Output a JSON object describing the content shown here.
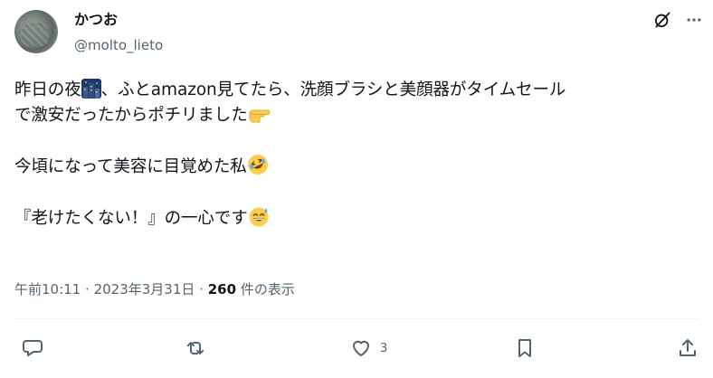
{
  "author": {
    "name": "かつお",
    "handle": "@molto_lieto"
  },
  "tweet": {
    "line1_a": "昨日の夜",
    "line1_b": "、ふとamazon見てたら、洗顔ブラシと美顔器がタイムセール",
    "line2": "で激安だったからポチリました",
    "line3": "今頃になって美容に目覚めた私",
    "line4": "『老けたくない！』の一心です"
  },
  "meta": {
    "time": "午前10:11",
    "sep": "·",
    "date": "2023年3月31日",
    "views": "260",
    "views_label": "件の表示"
  },
  "actions": {
    "likes": "3"
  },
  "icons": [
    "grok-icon",
    "more-icon",
    "night-city-emoji",
    "pointing-hand-emoji",
    "rolling-laughing-emoji",
    "sweat-smile-emoji",
    "reply-icon",
    "retweet-icon",
    "like-icon",
    "bookmark-icon",
    "share-icon"
  ],
  "colors": {
    "text": "#0f1419",
    "secondary": "#536471",
    "divider": "#eff3f4"
  }
}
